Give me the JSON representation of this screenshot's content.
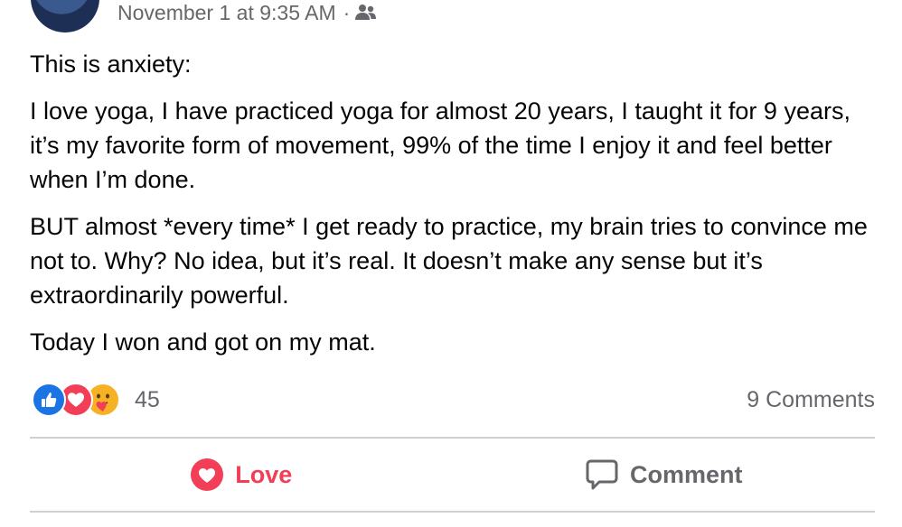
{
  "header": {
    "timestamp": "November 1 at 9:35 AM",
    "separator": "·",
    "audience_icon": "friends-icon"
  },
  "post": {
    "paragraphs": [
      "This is anxiety:",
      "I love yoga, I have practiced yoga for almost 20 years, I taught it for 9 years, it’s my favorite form of movement, 99% of the time I enjoy it and feel better when I’m done.",
      "BUT almost *every time* I get ready to practice, my brain tries to convince me not to. Why? No idea, but it’s real. It doesn’t make any sense but it’s extraordinarily powerful.",
      "Today I won and got on my mat."
    ]
  },
  "reactions": {
    "icons": [
      "like-icon",
      "love-icon",
      "care-icon"
    ],
    "count": "45",
    "comments_label": "9 Comments"
  },
  "actions": {
    "love_label": "Love",
    "comment_label": "Comment"
  },
  "colors": {
    "love": "#f33e58",
    "like": "#1b74e4",
    "care": "#f7b125",
    "muted": "#65676b"
  }
}
